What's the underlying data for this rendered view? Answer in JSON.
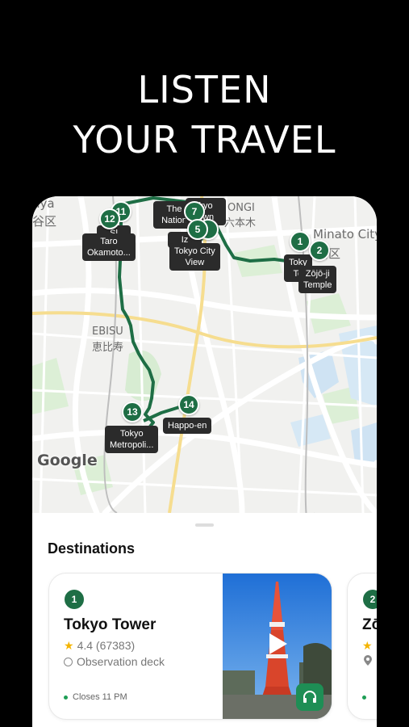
{
  "headline": {
    "line1": "LISTEN",
    "line2": "YOUR TRAVEL"
  },
  "map": {
    "district_labels": {
      "shibuya_partial": "uya",
      "shibuya_kanji_partial": "谷区",
      "roppongi": "ONGI",
      "roppongi_kanji": "六本木",
      "minato_city": "Minato City",
      "minato_kanji": "港区",
      "ebisu": "EBISU",
      "ebisu_kanji": "恵比寿"
    },
    "pins": [
      {
        "num": "1",
        "label_line1": "Toky",
        "label_line2": "To"
      },
      {
        "num": "2",
        "label_line1": "Zōjō-ji",
        "label_line2": "Temple"
      },
      {
        "num": "5",
        "label_line1": "Tokyo City",
        "label_line2": "View"
      },
      {
        "num": "7",
        "label_line1": "kyo",
        "label_line2": "own"
      },
      {
        "num": "11",
        "label_line1": "",
        "label_line2": ""
      },
      {
        "num": "12",
        "label_line1": "Taro",
        "label_line2": "Okamoto..."
      },
      {
        "num": "13",
        "label_line1": "Tokyo",
        "label_line2": "Metropoli..."
      },
      {
        "num": "14",
        "label_line1": "Happo-en",
        "label_line2": ""
      }
    ],
    "partial_tags": {
      "nation": "The\nNation",
      "iz": "Iz",
      "sl": "Sl"
    },
    "attribution": "Google",
    "route_color": "#1e6e45"
  },
  "sheet": {
    "title": "Destinations",
    "cards": [
      {
        "num": "1",
        "name": "Tokyo Tower",
        "rating": "4.4 (67383)",
        "category": "Observation deck",
        "status": "Closes 11 PM"
      },
      {
        "num": "2",
        "name": "Zō",
        "rating": "",
        "category": "",
        "status": ""
      }
    ]
  },
  "colors": {
    "brand_green": "#1e6e45",
    "status_green": "#1e9e55",
    "star": "#f4b400"
  },
  "icons": [
    "star-icon",
    "category-icon",
    "play-icon",
    "headphones-icon",
    "location-icon"
  ]
}
